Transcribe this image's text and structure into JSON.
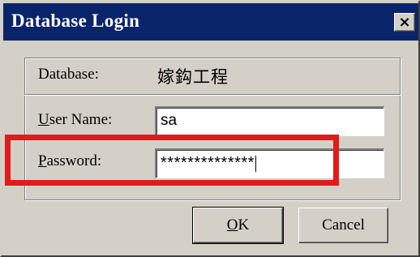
{
  "window": {
    "title": "Database Login",
    "close_glyph": "×"
  },
  "form": {
    "database_label": "Database:",
    "database_value": "嫁鈎工程",
    "username_label_accel": "U",
    "username_label_rest": "ser Name:",
    "username_value": "sa",
    "password_label_accel": "P",
    "password_label_rest": "assword:",
    "password_value": "**************"
  },
  "buttons": {
    "ok_accel": "O",
    "ok_rest": "K",
    "cancel": "Cancel"
  },
  "colors": {
    "titlebar": "#0a246a",
    "dialog_face": "#d4d0c8",
    "highlight_box": "#e21a1a"
  }
}
